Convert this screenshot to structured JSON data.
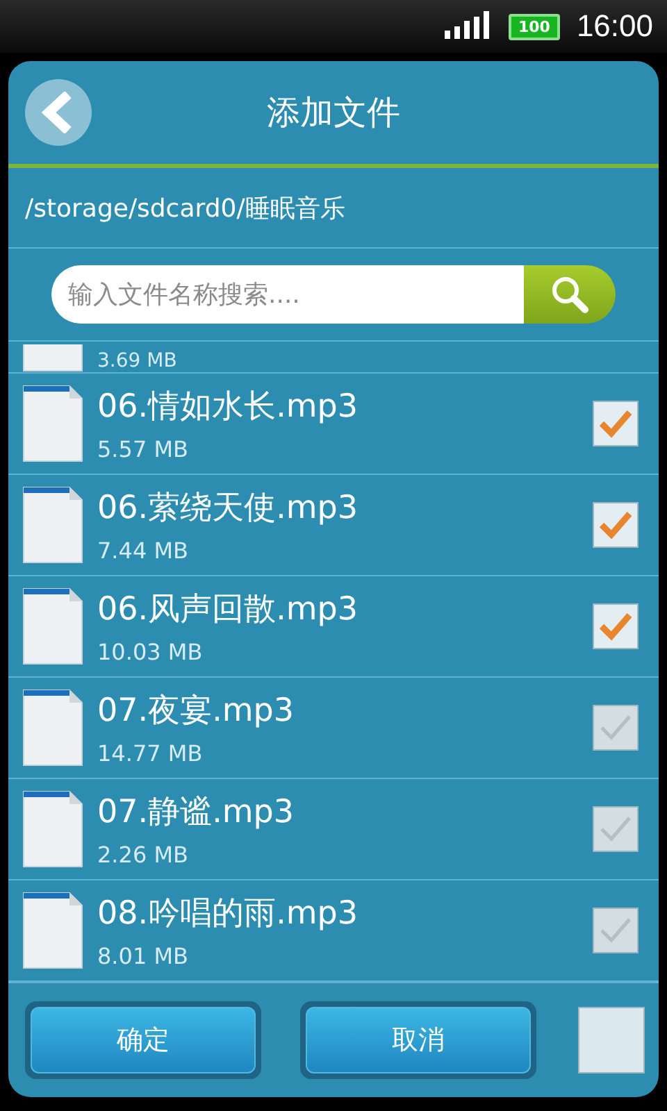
{
  "status_bar": {
    "battery": "100",
    "time": "16:00"
  },
  "header": {
    "title": "添加文件"
  },
  "path": "/storage/sdcard0/睡眠音乐",
  "search": {
    "placeholder": "输入文件名称搜索...."
  },
  "files": [
    {
      "kind": "partial",
      "size": "3.69 MB"
    },
    {
      "kind": "file",
      "name": "06.情如水长.mp3",
      "size": "5.57 MB",
      "checked": true
    },
    {
      "kind": "file",
      "name": "06.萦绕天使.mp3",
      "size": "7.44 MB",
      "checked": true
    },
    {
      "kind": "file",
      "name": "06.风声回散.mp3",
      "size": "10.03 MB",
      "checked": true
    },
    {
      "kind": "file",
      "name": "07.夜宴.mp3",
      "size": "14.77 MB",
      "checked": false
    },
    {
      "kind": "file",
      "name": "07.静谧.mp3",
      "size": "2.26 MB",
      "checked": false
    },
    {
      "kind": "file",
      "name": "08.吟唱的雨.mp3",
      "size": "8.01 MB",
      "checked": false
    }
  ],
  "buttons": [
    "确定",
    "取消"
  ],
  "select_all": {
    "checked": false
  }
}
